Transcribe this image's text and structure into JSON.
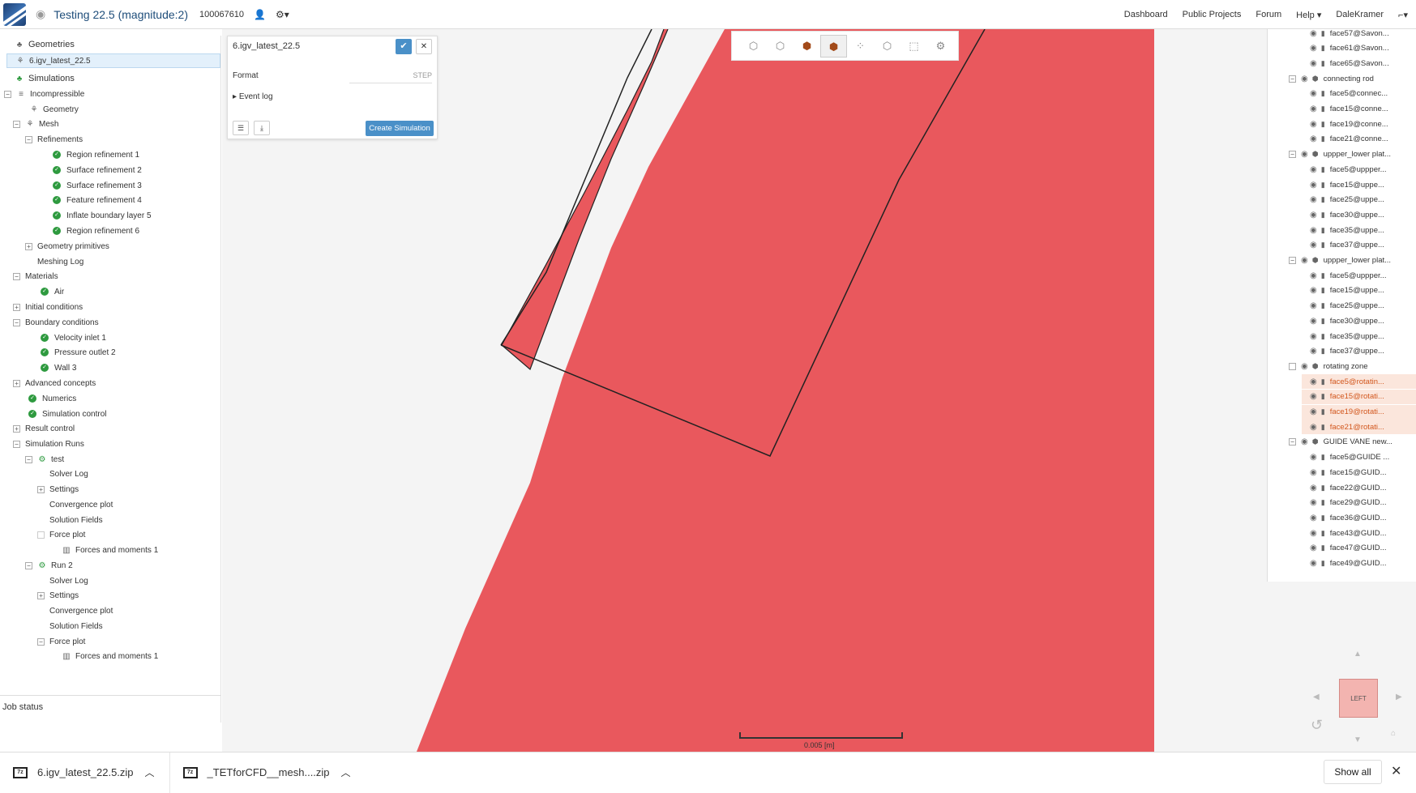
{
  "header": {
    "project_title": "Testing 22.5 (magnitude:2)",
    "project_id": "100067610",
    "nav": [
      "Dashboard",
      "Public Projects",
      "Forum",
      "Help ▾",
      "DaleKramer"
    ]
  },
  "tree": {
    "geometries_label": "Geometries",
    "geometry_item": "6.igv_latest_22.5",
    "simulations_label": "Simulations",
    "items": [
      {
        "label": "Incompressible"
      },
      {
        "label": "Geometry"
      },
      {
        "label": "Mesh"
      },
      {
        "label": "Refinements"
      },
      {
        "label": "Region refinement 1"
      },
      {
        "label": "Surface refinement 2"
      },
      {
        "label": "Surface refinement 3"
      },
      {
        "label": "Feature refinement 4"
      },
      {
        "label": "Inflate boundary layer 5"
      },
      {
        "label": "Region refinement 6"
      },
      {
        "label": "Geometry primitives"
      },
      {
        "label": "Meshing Log"
      },
      {
        "label": "Materials"
      },
      {
        "label": "Air"
      },
      {
        "label": "Initial conditions"
      },
      {
        "label": "Boundary conditions"
      },
      {
        "label": "Velocity inlet 1"
      },
      {
        "label": "Pressure outlet 2"
      },
      {
        "label": "Wall 3"
      },
      {
        "label": "Advanced concepts"
      },
      {
        "label": "Numerics"
      },
      {
        "label": "Simulation control"
      },
      {
        "label": "Result control"
      },
      {
        "label": "Simulation Runs"
      },
      {
        "label": "test"
      },
      {
        "label": "Solver Log"
      },
      {
        "label": "Settings"
      },
      {
        "label": "Convergence plot"
      },
      {
        "label": "Solution Fields"
      },
      {
        "label": "Force plot"
      },
      {
        "label": "Forces and moments 1"
      },
      {
        "label": "Run 2"
      },
      {
        "label": "Solver Log"
      },
      {
        "label": "Settings"
      },
      {
        "label": "Convergence plot"
      },
      {
        "label": "Solution Fields"
      },
      {
        "label": "Force plot"
      },
      {
        "label": "Forces and moments 1"
      }
    ],
    "job_status": "Job status"
  },
  "form": {
    "title": "6.igv_latest_22.5",
    "format_label": "Format",
    "format_value": "STEP",
    "event_log": "Event log",
    "create_button": "Create Simulation"
  },
  "right_tree": [
    {
      "label": "face57@Savon..."
    },
    {
      "label": "face61@Savon..."
    },
    {
      "label": "face65@Savon..."
    },
    {
      "label": "connecting rod"
    },
    {
      "label": "face5@connec..."
    },
    {
      "label": "face15@conne..."
    },
    {
      "label": "face19@conne..."
    },
    {
      "label": "face21@conne..."
    },
    {
      "label": "uppper_lower plat..."
    },
    {
      "label": "face5@uppper..."
    },
    {
      "label": "face15@uppe..."
    },
    {
      "label": "face25@uppe..."
    },
    {
      "label": "face30@uppe..."
    },
    {
      "label": "face35@uppe..."
    },
    {
      "label": "face37@uppe..."
    },
    {
      "label": "uppper_lower plat..."
    },
    {
      "label": "face5@uppper..."
    },
    {
      "label": "face15@uppe..."
    },
    {
      "label": "face25@uppe..."
    },
    {
      "label": "face30@uppe..."
    },
    {
      "label": "face35@uppe..."
    },
    {
      "label": "face37@uppe..."
    },
    {
      "label": "rotating zone"
    },
    {
      "label": "face5@rotatin..."
    },
    {
      "label": "face15@rotati..."
    },
    {
      "label": "face19@rotati..."
    },
    {
      "label": "face21@rotati..."
    },
    {
      "label": "GUIDE VANE new..."
    },
    {
      "label": "face5@GUIDE ..."
    },
    {
      "label": "face15@GUID..."
    },
    {
      "label": "face22@GUID..."
    },
    {
      "label": "face29@GUID..."
    },
    {
      "label": "face36@GUID..."
    },
    {
      "label": "face43@GUID..."
    },
    {
      "label": "face47@GUID..."
    },
    {
      "label": "face49@GUID..."
    }
  ],
  "viewport": {
    "scale_label": "0.005 [m]",
    "navcube_label": "LEFT",
    "geometry_fill": "#e9585d"
  },
  "downloads": {
    "items": [
      {
        "name": "6.igv_latest_22.5.zip"
      },
      {
        "name": "_TETforCFD__mesh....zip"
      }
    ],
    "show_all": "Show all"
  },
  "colors": {
    "accent": "#4a90c8",
    "success": "#2e9a3f",
    "highlight": "#d2561c"
  }
}
